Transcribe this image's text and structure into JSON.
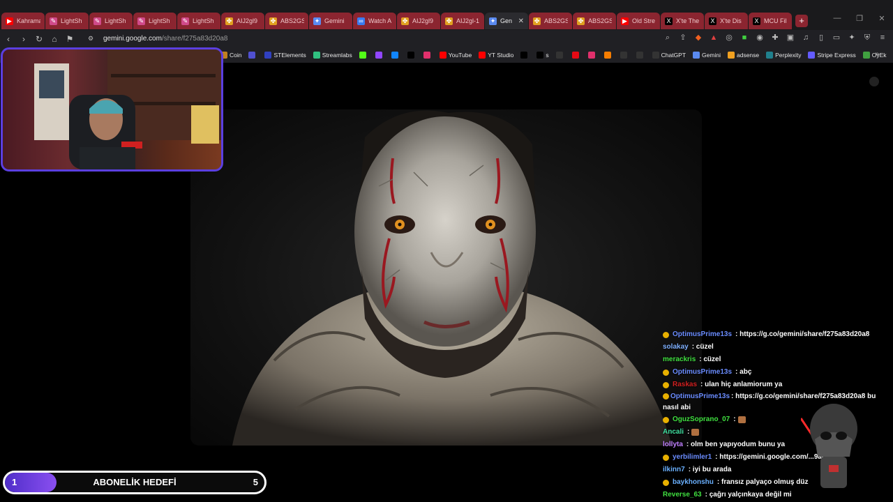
{
  "tabs": [
    {
      "title": "Kahrama",
      "icon": "youtube-icon",
      "color": "#ff0000"
    },
    {
      "title": "LightSh",
      "icon": "feather-icon",
      "color": "#d04a8a"
    },
    {
      "title": "LightSh",
      "icon": "feather-icon",
      "color": "#d04a8a"
    },
    {
      "title": "LightSh",
      "icon": "feather-icon",
      "color": "#d04a8a"
    },
    {
      "title": "LightSh",
      "icon": "feather-icon",
      "color": "#d04a8a"
    },
    {
      "title": "AIJ2gl9",
      "icon": "pinwheel-icon",
      "color": "#e0a020"
    },
    {
      "title": "ABS2GS",
      "icon": "pinwheel-icon",
      "color": "#e0a020"
    },
    {
      "title": "Gemini",
      "icon": "gemini-icon",
      "color": "#5a8af0"
    },
    {
      "title": "Watch A",
      "icon": "infinity-icon",
      "color": "#3b7bf0"
    },
    {
      "title": "AIJ2gl9",
      "icon": "pinwheel-icon",
      "color": "#e0a020"
    },
    {
      "title": "AIJ2gl-1",
      "icon": "pinwheel-icon",
      "color": "#e0a020"
    },
    {
      "title": "Gen",
      "icon": "gemini-icon",
      "color": "#5a8af0",
      "active": true
    },
    {
      "title": "ABS2GS",
      "icon": "pinwheel-icon",
      "color": "#e0a020"
    },
    {
      "title": "ABS2GS",
      "icon": "pinwheel-icon",
      "color": "#e0a020"
    },
    {
      "title": "Old Stre",
      "icon": "youtube-icon",
      "color": "#ff0000"
    },
    {
      "title": "X'te The",
      "icon": "x-icon",
      "color": "#000000"
    },
    {
      "title": "X'te Dis",
      "icon": "x-icon",
      "color": "#000000"
    },
    {
      "title": "MCU Fil",
      "icon": "x-icon",
      "color": "#000000"
    }
  ],
  "address": {
    "host": "gemini.google.com",
    "path": "/share/f275a83d20a8"
  },
  "bookmarks": [
    {
      "label": "Coin",
      "icon": "coin-icon"
    },
    {
      "label": "",
      "icon": "r-icon"
    },
    {
      "label": "STElements",
      "icon": "st-icon"
    },
    {
      "label": "Streamlabs",
      "icon": "streamlabs-icon"
    },
    {
      "label": "",
      "icon": "kick-icon"
    },
    {
      "label": "",
      "icon": "twitch-icon"
    },
    {
      "label": "",
      "icon": "bluesky-icon"
    },
    {
      "label": "",
      "icon": "x-icon"
    },
    {
      "label": "",
      "icon": "instagram-icon"
    },
    {
      "label": "YouTube",
      "icon": "youtube-icon"
    },
    {
      "label": "YT Studio",
      "icon": "yt-studio-icon"
    },
    {
      "label": "",
      "icon": "tiktok-icon"
    },
    {
      "label": "s",
      "icon": "tiktok-icon"
    },
    {
      "label": "",
      "icon": "circle-icon"
    },
    {
      "label": "",
      "icon": "netflix-icon"
    },
    {
      "label": "",
      "icon": "app-icon"
    },
    {
      "label": "",
      "icon": "blogger-icon"
    },
    {
      "label": "",
      "icon": "amazon-icon"
    },
    {
      "label": "",
      "icon": "capcut-icon"
    },
    {
      "label": "ChatGPT",
      "icon": "chatgpt-icon"
    },
    {
      "label": "Gemini",
      "icon": "gemini-icon"
    },
    {
      "label": "adsense",
      "icon": "adsense-icon"
    },
    {
      "label": "Perplexity",
      "icon": "perplexity-icon"
    },
    {
      "label": "Stripe Express",
      "icon": "stripe-icon"
    },
    {
      "label": "OyEk",
      "icon": "oyek-icon"
    }
  ],
  "chat": [
    {
      "user": "OptimusPrime13s",
      "color": "#6a8cff",
      "badge": true,
      "text": ": https://g.co/gemini/share/f275a83d20a8"
    },
    {
      "user": "solakay",
      "color": "#7fb0ff",
      "badge": false,
      "text": ": cüzel"
    },
    {
      "user": "merackris",
      "color": "#40e040",
      "badge": false,
      "text": ": cüzel"
    },
    {
      "user": "OptimusPrime13s",
      "color": "#6a8cff",
      "badge": true,
      "text": ": abç"
    },
    {
      "user": "Raskas",
      "color": "#d02020",
      "badge": true,
      "text": ": ulan hiç anlamiorum ya"
    },
    {
      "user": "OptimusPrime13s",
      "color": "#6a8cff",
      "badge": true,
      "text": ": https://g.co/gemini/share/f275a83d20a8 bu nasıl abi",
      "wrap": true
    },
    {
      "user": "OguzSoprano_07",
      "color": "#40e040",
      "badge": true,
      "text": ":"
    },
    {
      "user": "Ancali",
      "color": "#40e0a0",
      "badge": false,
      "text": ":"
    },
    {
      "user": "lollyta",
      "color": "#c080ff",
      "badge": false,
      "text": ": olm ben yapıyodum bunu ya"
    },
    {
      "user": "yerbilimler1",
      "color": "#6a8cff",
      "badge": true,
      "text": ": https://gemini.google.com/...9adf46"
    },
    {
      "user": "ilkinn7",
      "color": "#6ab0ff",
      "badge": false,
      "text": ": iyi bu arada"
    },
    {
      "user": "baykhonshu",
      "color": "#6ab0ff",
      "badge": true,
      "text": ": fransız palyaço olmuş düz"
    },
    {
      "user": "Reverse_63",
      "color": "#40e040",
      "badge": false,
      "text": ": çağrı yalçınkaya değil mi"
    }
  ],
  "subgoal": {
    "current": "1",
    "label": "ABONELİK HEDEFİ",
    "target": "5",
    "progress": 0.2
  },
  "colors": {
    "accent": "#5b3fe0",
    "tab_bg": "#8b2530"
  }
}
